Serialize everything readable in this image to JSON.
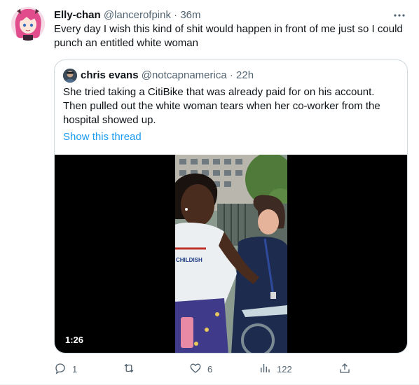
{
  "tweet": {
    "author_name": "Elly-chan",
    "author_handle": "@lancerofpink",
    "separator": "·",
    "time": "36m",
    "text": "Every day I wish this kind of shit would happen in front of me just so I could punch an entitled white woman"
  },
  "quoted": {
    "author_name": "chris evans",
    "author_handle": "@notcapnamerica",
    "separator": "·",
    "time": "22h",
    "text": "She tried taking a CitiBike that was already paid for on his account. Then pulled out the white woman tears when her co-worker from the hospital showed up.",
    "show_thread": "Show this thread",
    "video": {
      "duration": "1:26",
      "shirt_text": "CHILDISH"
    }
  },
  "actions": {
    "replies": "1",
    "retweets": "",
    "likes": "6",
    "views": "122"
  },
  "colors": {
    "accent": "#1d9bf0",
    "muted": "#536471",
    "border": "#cfd9de"
  },
  "icons": [
    "more-icon",
    "reply-icon",
    "retweet-icon",
    "like-icon",
    "views-icon",
    "share-icon"
  ]
}
